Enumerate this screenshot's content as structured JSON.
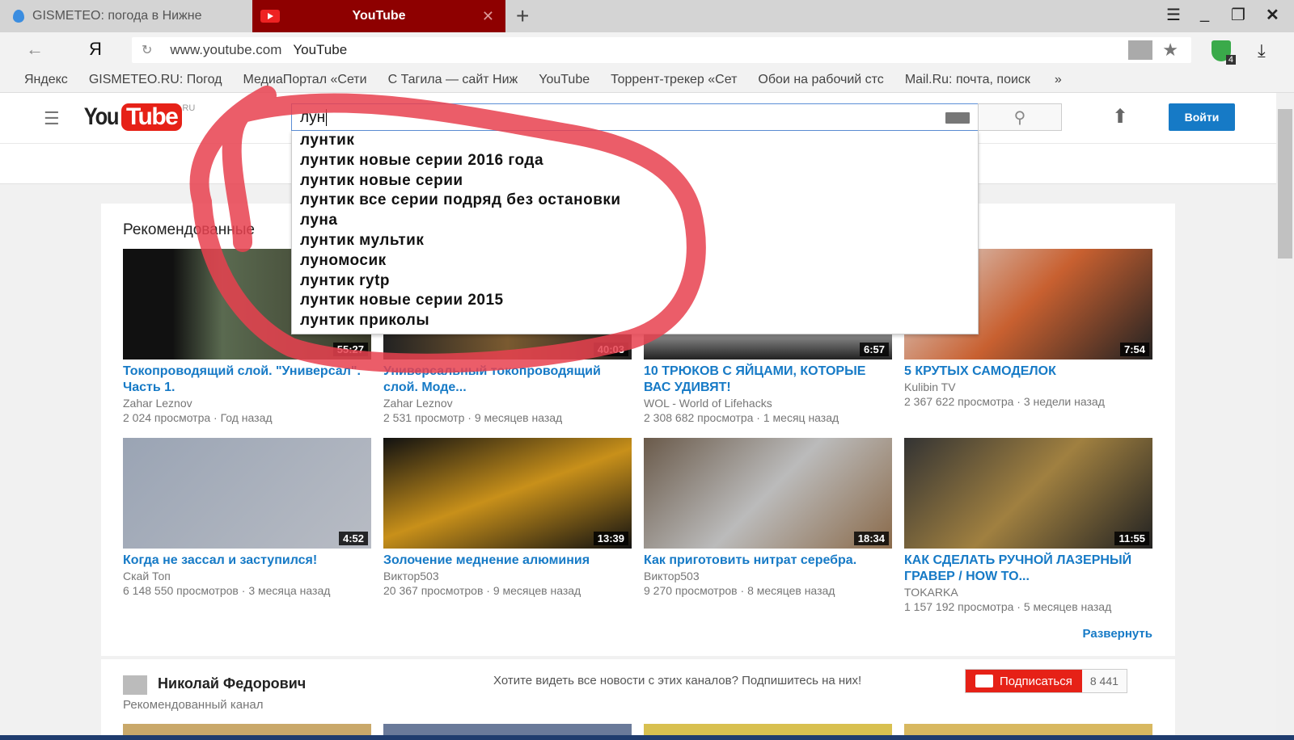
{
  "browser": {
    "tabs": [
      {
        "label": "GISMETEO: погода в Нижне",
        "icon": "gismeteo-drop-icon"
      },
      {
        "label": "YouTube",
        "icon": "youtube-icon",
        "active": true
      }
    ],
    "url": "www.youtube.com",
    "page_title": "YouTube",
    "yandex_label": "Я",
    "bookmarks": [
      "Яндекс",
      "GISMETEO.RU: Погод",
      "МедиаПортал «Сети",
      "С Тагила — сайт Ниж",
      "YouTube",
      "Торрент-трекер «Сет",
      "Обои на рабочий стс",
      "Mail.Ru: почта, поиск"
    ],
    "more": "»",
    "extension_badge": "4"
  },
  "youtube": {
    "logo_you": "You",
    "logo_tube": "Tube",
    "region": "RU",
    "search_value": "лун",
    "login": "Войти",
    "suggestions": [
      "лунтик",
      "лунтик новые серии 2016 года",
      "лунтик новые серии",
      "лунтик все серии подряд без остановки",
      "луна",
      "лунтик мультик",
      "луномосик",
      "лунтик rytp",
      "лунтик новые серии 2015",
      "лунтик приколы"
    ],
    "section_title": "Рекомендованные",
    "videos": [
      {
        "title": "Токопроводящий слой. \"Универсал\". Часть 1.",
        "channel": "Zahar Leznov",
        "views": "2 024 просмотра",
        "age": "Год назад",
        "duration": "55:27"
      },
      {
        "title": "Универсальный токопроводящий слой. Моде...",
        "channel": "Zahar Leznov",
        "views": "2 531 просмотр",
        "age": "9 месяцев назад",
        "duration": "40:03"
      },
      {
        "title": "10 ТРЮКОВ С ЯЙЦАМИ, КОТОРЫЕ ВАС УДИВЯТ!",
        "channel": "WOL - World of Lifehacks",
        "views": "2 308 682 просмотра",
        "age": "1 месяц назад",
        "duration": "6:57"
      },
      {
        "title": "5 КРУТЫХ САМОДЕЛОК",
        "channel": "Kulibin TV",
        "views": "2 367 622 просмотра",
        "age": "3 недели назад",
        "duration": "7:54"
      },
      {
        "title": "Когда не зассал и заступился!",
        "channel": "Скай Топ",
        "views": "6 148 550 просмотров",
        "age": "3 месяца назад",
        "duration": "4:52"
      },
      {
        "title": "Золочение меднение алюминия",
        "channel": "Виктор503",
        "views": "20 367 просмотров",
        "age": "9 месяцев назад",
        "duration": "13:39"
      },
      {
        "title": "Как приготовить нитрат серебра.",
        "channel": "Виктор503",
        "views": "9 270 просмотров",
        "age": "8 месяцев назад",
        "duration": "18:34"
      },
      {
        "title": "КАК СДЕЛАТЬ РУЧНОЙ ЛАЗЕРНЫЙ ГРАВЕР / HOW TO...",
        "channel": "TOKARKA",
        "views": "1 157 192 просмотра",
        "age": "5 месяцев назад",
        "duration": "11:55"
      }
    ],
    "expand": "Развернуть",
    "channel": {
      "name": "Николай Федорович",
      "subtitle": "Рекомендованный канал",
      "prompt": "Хотите видеть все новости с этих каналов? Подпишитесь на них!",
      "subscribe": "Подписаться",
      "subscribers": "8 441"
    }
  },
  "colors": {
    "accent": "#167ac6",
    "youtube_red": "#e62117",
    "tab_active": "#8e0000",
    "annotation": "#e8414f"
  }
}
